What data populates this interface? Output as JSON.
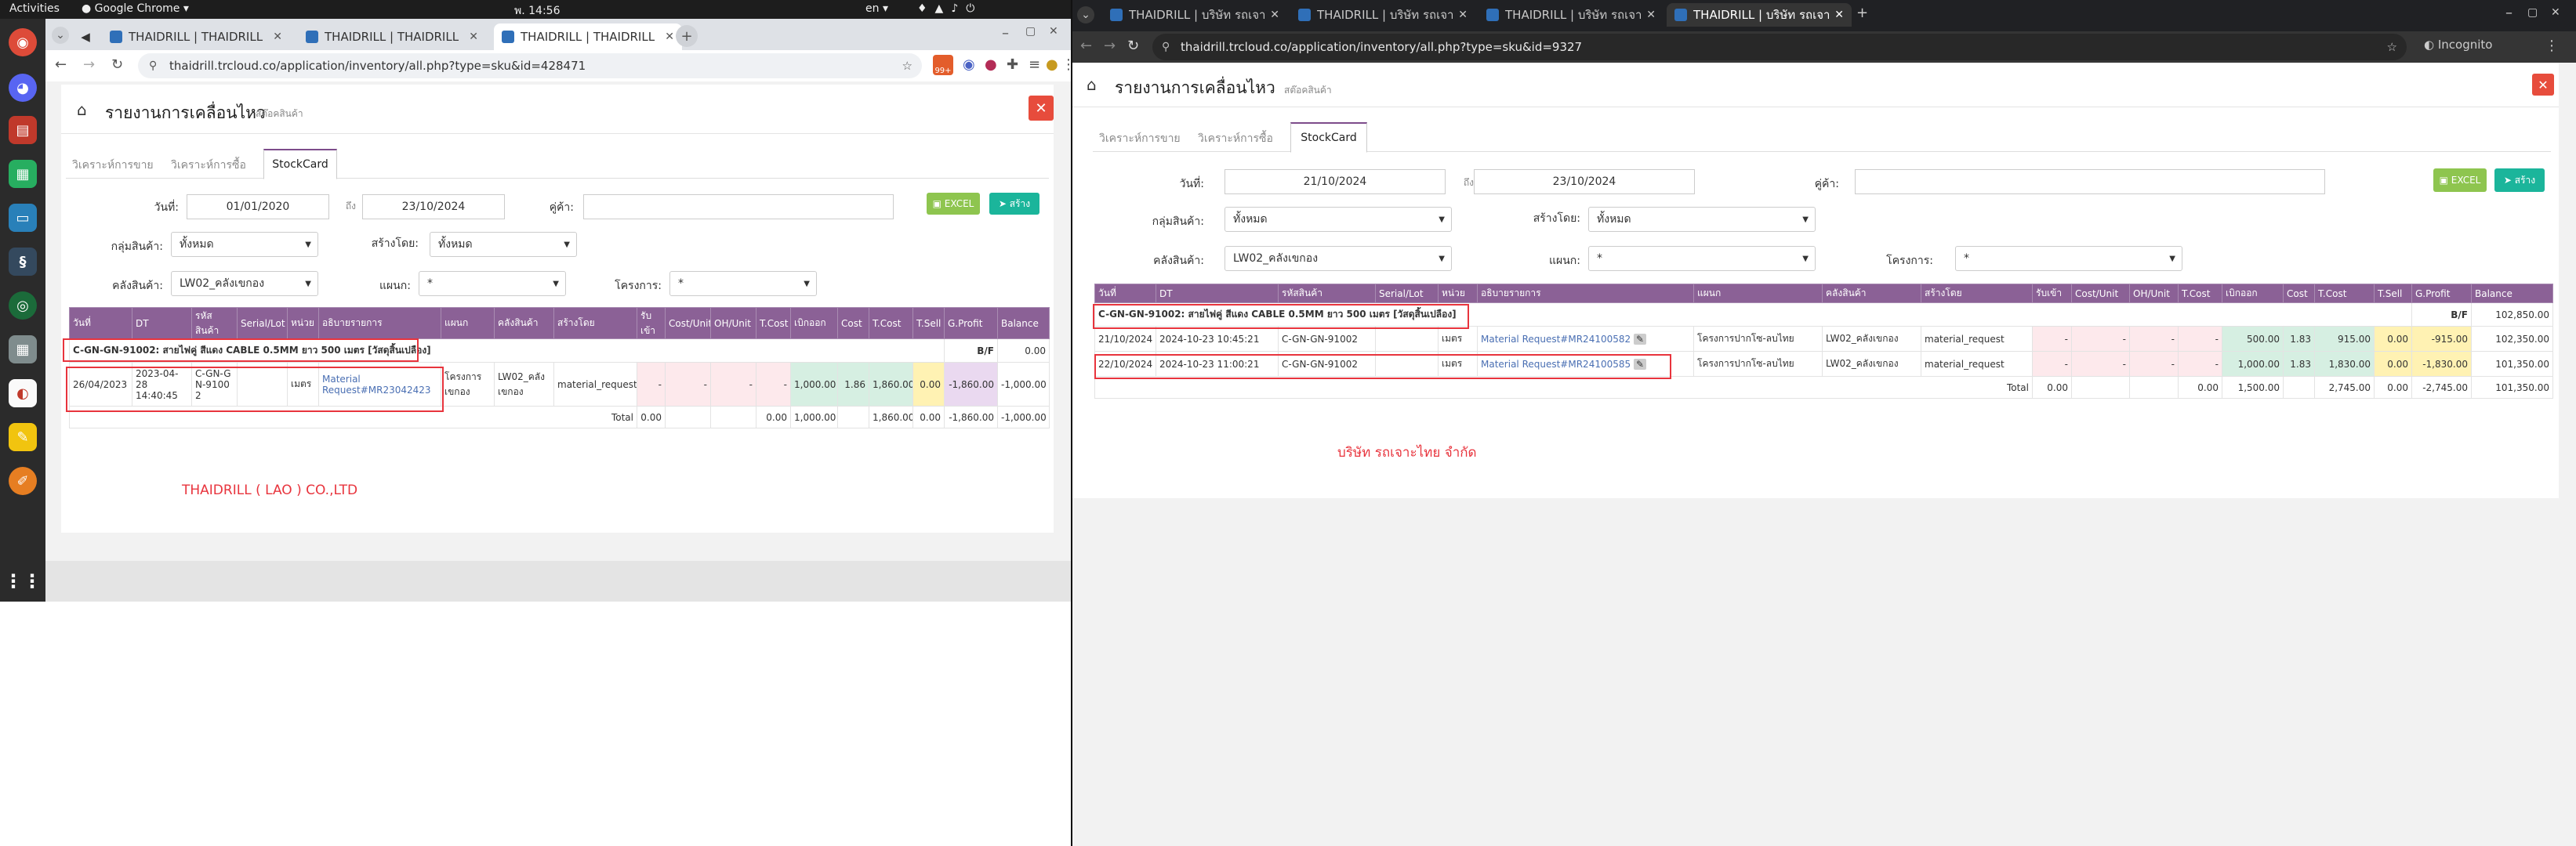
{
  "topbar": {
    "activities": "Activities",
    "app": "Google Chrome",
    "clock": "พ. 14:56",
    "lang": "en"
  },
  "left": {
    "tabs": [
      {
        "label": "THAIDRILL | THAIDRILL |"
      },
      {
        "label": "THAIDRILL | THAIDRILL |"
      },
      {
        "label": "THAIDRILL | THAIDRILL |"
      }
    ],
    "url": "thaidrill.trcloud.co/application/inventory/all.php?type=sku&id=428471",
    "badge": "99+",
    "page_title": "รายงานการเคลื่อนไหว",
    "page_subtitle": "สต๊อคสินค้า",
    "tabs_page": [
      "วิเคราะห์การขาย",
      "วิเคราะห์การซื้อ",
      "StockCard"
    ],
    "filters": {
      "date_label": "วันที่:",
      "date_from": "01/01/2020",
      "to_label": "ถึง",
      "date_to": "23/10/2024",
      "partner_label": "คู่ค้า:",
      "partner_value": "",
      "group_label": "กลุ่มสินค้า:",
      "group_value": "ทั้งหมด",
      "creator_label": "สร้างโดย:",
      "creator_value": "ทั้งหมด",
      "warehouse_label": "คลังสินค้า:",
      "warehouse_value": "LW02_คลังเขกอง",
      "dept_label": "แผนก:",
      "dept_value": "*",
      "project_label": "โครงการ:",
      "project_value": "*"
    },
    "buttons": {
      "excel": "EXCEL",
      "create": "สร้าง"
    },
    "headers": [
      "วันที่",
      "DT",
      "รหัสสินค้า",
      "Serial/Lot",
      "หน่วย",
      "อธิบายรายการ",
      "แผนก",
      "คลังสินค้า",
      "สร้างโดย",
      "รับเข้า",
      "Cost/Unit",
      "OH/Unit",
      "T.Cost",
      "เบิกออก",
      "Cost",
      "T.Cost",
      "T.Sell",
      "G.Profit",
      "Balance"
    ],
    "product_row": {
      "label": "C-GN-GN-91002: สายไฟคู่ สีแดง CABLE 0.5MM ยาว 500 เมตร [วัสดุสิ้นเปลือง]",
      "bf": "B/F",
      "balance": "0.00"
    },
    "rows": [
      {
        "date": "26/04/2023",
        "dt": "2023-04-28 14:40:45",
        "sku": "C-GN-GN-91002",
        "serial": "",
        "unit": "เมตร",
        "desc": "Material Request#MR23042423",
        "dept": "โครงการเขกอง",
        "wh": "LW02_คลังเขกอง",
        "by": "material_request",
        "in": "-",
        "cpu": "-",
        "oh": "-",
        "tc": "-",
        "out": "1,000.00",
        "cost": "1.86",
        "tcost": "1,860.00",
        "tsell": "0.00",
        "gp": "-1,860.00",
        "bal": "-1,000.00"
      }
    ],
    "total": {
      "label": "Total",
      "in": "0.00",
      "tc": "0.00",
      "out": "1,000.00",
      "tcost": "1,860.00",
      "tsell": "0.00",
      "gp": "-1,860.00",
      "bal": "-1,000.00"
    },
    "company": "THAIDRILL ( LAO ) CO.,LTD"
  },
  "right": {
    "tabs": [
      {
        "label": "THAIDRILL | บริษัท รถเจาะ"
      },
      {
        "label": "THAIDRILL | บริษัท รถเจาะ"
      },
      {
        "label": "THAIDRILL | บริษัท รถเจาะ"
      },
      {
        "label": "THAIDRILL | บริษัท รถเจาะ"
      }
    ],
    "url": "thaidrill.trcloud.co/application/inventory/all.php?type=sku&id=9327",
    "incognito": "Incognito",
    "page_title": "รายงานการเคลื่อนไหว",
    "page_subtitle": "สต๊อคสินค้า",
    "tabs_page": [
      "วิเคราะห์การขาย",
      "วิเคราะห์การซื้อ",
      "StockCard"
    ],
    "filters": {
      "date_label": "วันที่:",
      "date_from": "21/10/2024",
      "to_label": "ถึง",
      "date_to": "23/10/2024",
      "partner_label": "คู่ค้า:",
      "partner_value": "",
      "group_label": "กลุ่มสินค้า:",
      "group_value": "ทั้งหมด",
      "creator_label": "สร้างโดย:",
      "creator_value": "ทั้งหมด",
      "warehouse_label": "คลังสินค้า:",
      "warehouse_value": "LW02_คลังเขกอง",
      "dept_label": "แผนก:",
      "dept_value": "*",
      "project_label": "โครงการ:",
      "project_value": "*"
    },
    "buttons": {
      "excel": "EXCEL",
      "create": "สร้าง"
    },
    "headers": [
      "วันที่",
      "DT",
      "รหัสสินค้า",
      "Serial/Lot",
      "หน่วย",
      "อธิบายรายการ",
      "แผนก",
      "คลังสินค้า",
      "สร้างโดย",
      "รับเข้า",
      "Cost/Unit",
      "OH/Unit",
      "T.Cost",
      "เบิกออก",
      "Cost",
      "T.Cost",
      "T.Sell",
      "G.Profit",
      "Balance"
    ],
    "product_row": {
      "label": "C-GN-GN-91002: สายไฟคู่ สีแดง CABLE 0.5MM ยาว 500 เมตร [วัสดุสิ้นเปลือง]",
      "bf": "B/F",
      "balance": "102,850.00"
    },
    "rows": [
      {
        "date": "21/10/2024",
        "dt": "2024-10-23 10:45:21",
        "sku": "C-GN-GN-91002",
        "serial": "",
        "unit": "เมตร",
        "desc": "Material Request#MR24100582",
        "dept": "โครงการปากโซ-ลบไทย",
        "wh": "LW02_คลังเขกอง",
        "by": "material_request",
        "in": "-",
        "cpu": "-",
        "oh": "-",
        "tc": "-",
        "out": "500.00",
        "cost": "1.83",
        "tcost": "915.00",
        "tsell": "0.00",
        "gp": "-915.00",
        "bal": "102,350.00"
      },
      {
        "date": "22/10/2024",
        "dt": "2024-10-23 11:00:21",
        "sku": "C-GN-GN-91002",
        "serial": "",
        "unit": "เมตร",
        "desc": "Material Request#MR24100585",
        "dept": "โครงการปากโซ-ลบไทย",
        "wh": "LW02_คลังเขกอง",
        "by": "material_request",
        "in": "-",
        "cpu": "-",
        "oh": "-",
        "tc": "-",
        "out": "1,000.00",
        "cost": "1.83",
        "tcost": "1,830.00",
        "tsell": "0.00",
        "gp": "-1,830.00",
        "bal": "101,350.00"
      }
    ],
    "total": {
      "label": "Total",
      "in": "0.00",
      "tc": "0.00",
      "out": "1,500.00",
      "tcost": "2,745.00",
      "tsell": "0.00",
      "gp": "-2,745.00",
      "bal": "101,350.00"
    },
    "company": "บริษัท รถเจาะไทย จำกัด"
  }
}
